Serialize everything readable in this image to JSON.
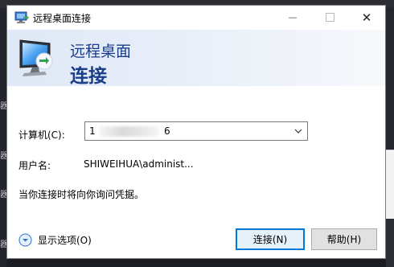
{
  "window": {
    "title": "远程桌面连接",
    "close_glyph": "✕",
    "minimize_glyph": "—"
  },
  "banner": {
    "line1": "远程桌面",
    "line2": "连接"
  },
  "form": {
    "computer_label": "计算机(C):",
    "computer_value_start": "1",
    "computer_value_end": "6",
    "user_label": "用户名:",
    "user_value": "SHIWEIHUA\\administ...",
    "info_text": "当你连接时将向你询问凭据。"
  },
  "footer": {
    "options_label": "显示选项(O)",
    "connect_label": "连接(N)",
    "help_label": "帮助(H)"
  },
  "colors": {
    "banner_text": "#1a3d8a",
    "default_button_border": "#0078d7",
    "options_icon": "#2a6fc9"
  }
}
